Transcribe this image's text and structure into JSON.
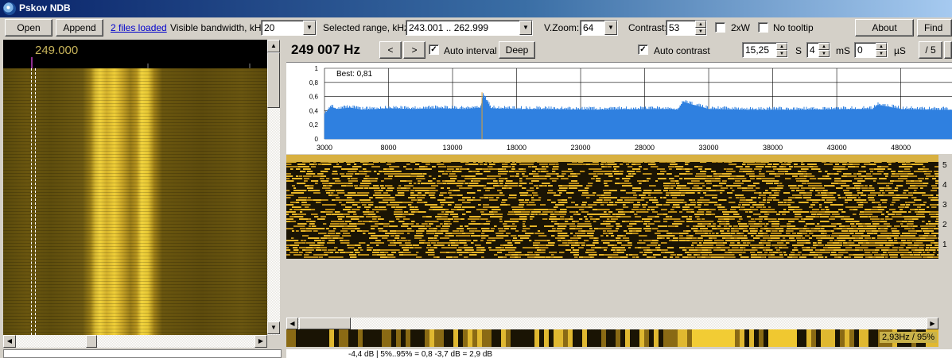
{
  "window": {
    "title": "Pskov NDB"
  },
  "toolbar": {
    "open_label": "Open",
    "append_label": "Append",
    "files_loaded_label": "2 files loaded",
    "visible_bandwidth_label": "Visible bandwidth, kHz:",
    "visible_bandwidth_value": "20",
    "selected_range_label": "Selected range, kHz:",
    "selected_range_value": "243.001 .. 262.999",
    "vzoom_label": "V.Zoom:",
    "vzoom_value": "64",
    "contrast_label": "Contrast:",
    "contrast_value": "53",
    "twoxw_label": "2xW",
    "twoxw_checked": false,
    "no_tooltip_label": "No tooltip",
    "no_tooltip_checked": false,
    "about_label": "About",
    "find_label": "Find kn"
  },
  "left": {
    "frequency_label": "249.000"
  },
  "right": {
    "frequency_display": "249 007 Hz",
    "prev_label": "<",
    "next_label": ">",
    "auto_interval_label": "Auto interval",
    "auto_interval_checked": true,
    "deep_label": "Deep",
    "auto_contrast_label": "Auto contrast",
    "auto_contrast_checked": true,
    "seconds_value": "15,25",
    "seconds_unit": "S",
    "ms_value": "4",
    "ms_unit": "mS",
    "us_value": "0",
    "us_unit": "µS",
    "div5_label": "/ 5",
    "best_label": "Best: 0,81",
    "colorbar_label": "2,93Hz / 95%",
    "bottom_text": "-4,4 dB | 5%..95% = 0,8 -3,7 dB = 2,9 dB",
    "waterfall_axis": [
      "5",
      "4",
      "3",
      "2",
      "1"
    ]
  },
  "chart_data": {
    "type": "area",
    "title": "",
    "annotation": "Best: 0,81",
    "xlabel": "",
    "ylabel": "",
    "ylim": [
      0,
      1
    ],
    "xlim": [
      3000,
      52000
    ],
    "yticks": [
      "1",
      "0,8",
      "0,6",
      "0,4",
      "0,2",
      "0"
    ],
    "xticks": [
      3000,
      8000,
      13000,
      18000,
      23000,
      28000,
      33000,
      38000,
      43000,
      48000
    ],
    "grid": true,
    "series": [
      {
        "color": "#2f80e0",
        "x": [
          3000,
          3500,
          4000,
          5000,
          6000,
          8000,
          10000,
          12000,
          14000,
          15200,
          15400,
          16000,
          18000,
          20000,
          24000,
          28000,
          30000,
          30600,
          31000,
          33000,
          36000,
          40000,
          44000,
          45800,
          46200,
          48000,
          50000,
          52000
        ],
        "values": [
          0.35,
          0.45,
          0.42,
          0.44,
          0.41,
          0.43,
          0.42,
          0.43,
          0.42,
          0.44,
          0.62,
          0.43,
          0.42,
          0.42,
          0.41,
          0.42,
          0.42,
          0.41,
          0.52,
          0.42,
          0.41,
          0.41,
          0.42,
          0.42,
          0.48,
          0.42,
          0.41,
          0.41
        ]
      }
    ],
    "peak_marker_x": 15300
  },
  "colors": {
    "waterfall_gold": "#f0cf38",
    "spectrum_blue": "#2f80e0",
    "background": "#d4d0c8"
  }
}
